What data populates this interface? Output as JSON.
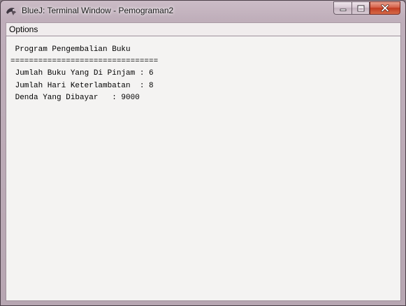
{
  "window": {
    "title": "BlueJ: Terminal Window - Pemograman2",
    "icon": "bluej-app-icon",
    "controls": [
      "minimize-icon",
      "maximize-icon",
      "close-icon"
    ]
  },
  "menubar": {
    "options_label": "Options"
  },
  "terminal": {
    "lines": [
      " Program Pengembalian Buku",
      "================================",
      " Jumlah Buku Yang Di Pinjam : 6",
      " Jumlah Hari Keterlambatan  : 8",
      " Denda Yang Dibayar   : 9000"
    ]
  },
  "colors": {
    "close_button": "#c94a30",
    "terminal_background": "#f4f3f2"
  }
}
